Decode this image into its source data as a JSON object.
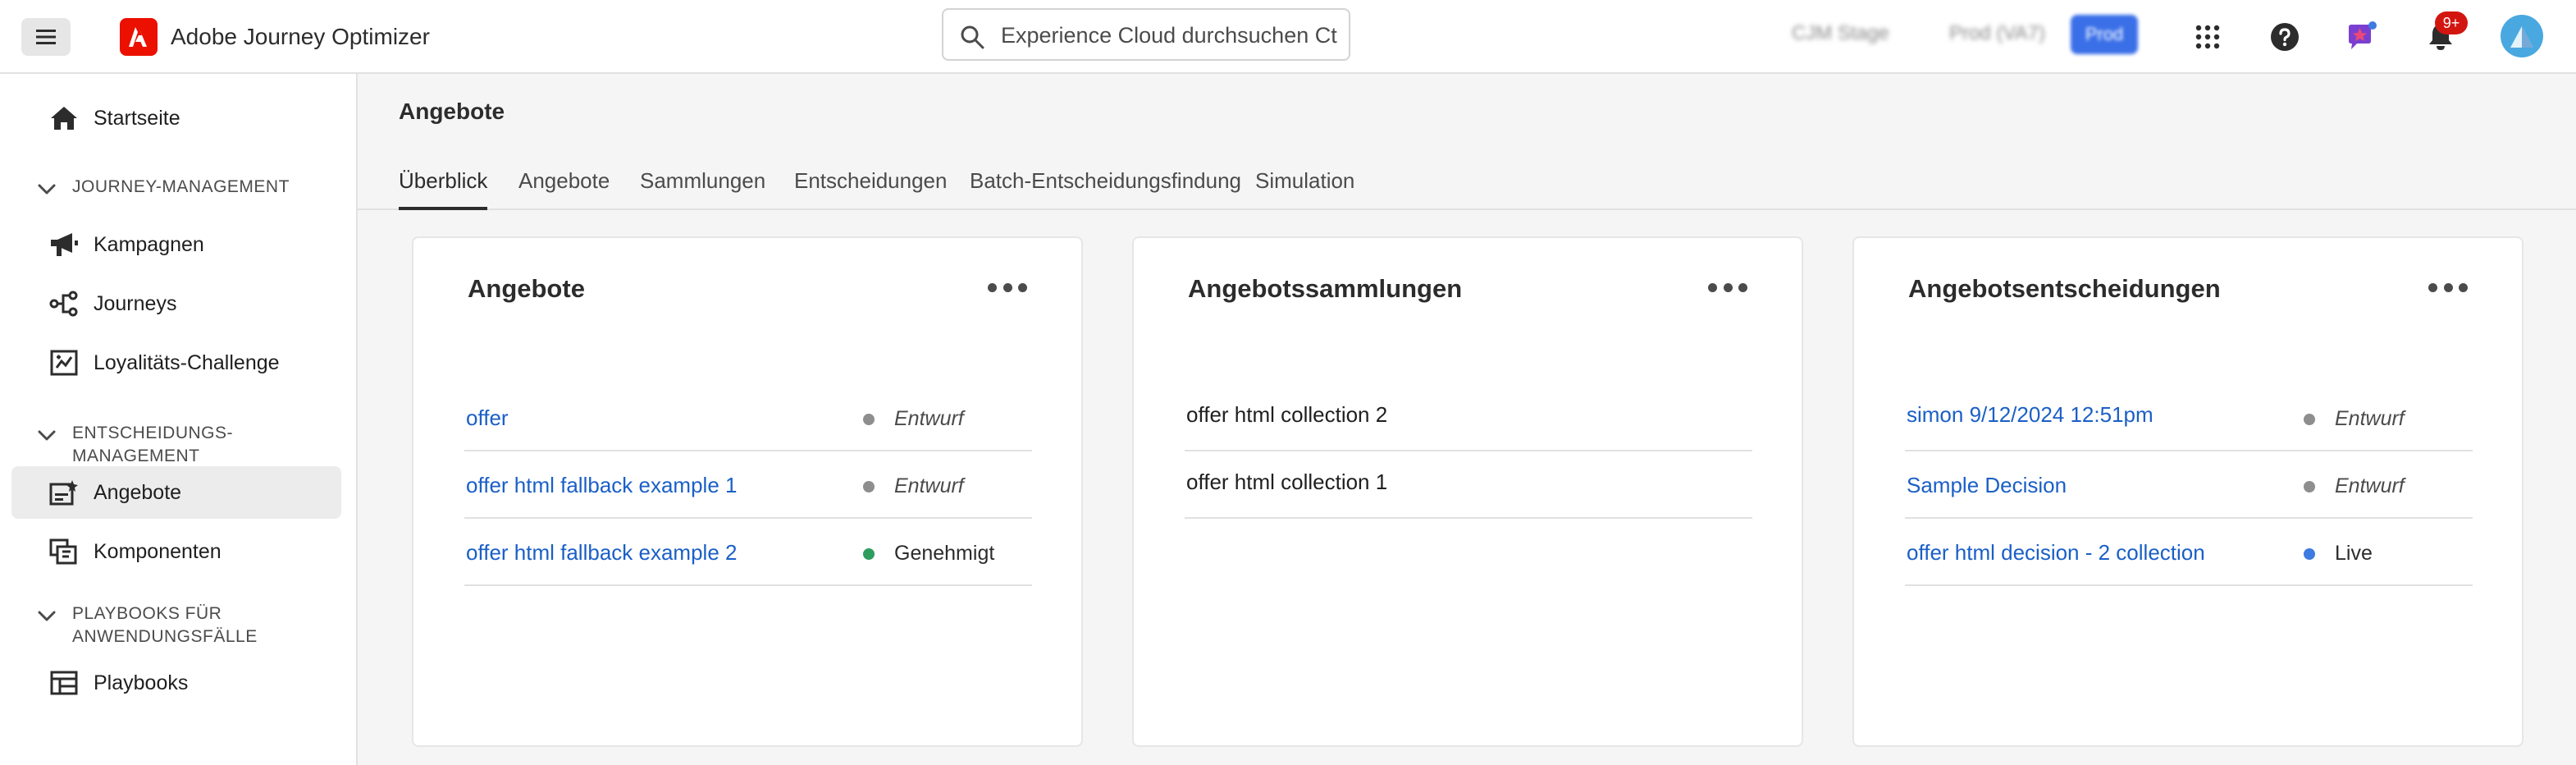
{
  "app": {
    "title": "Adobe Journey Optimizer"
  },
  "search": {
    "placeholder": "Experience Cloud durchsuchen Ctr..."
  },
  "header_blurred": {
    "org": "CJM Stage",
    "sandbox": "Prod (VA7)",
    "env_button": "Prod"
  },
  "notifications": {
    "badge": "9+"
  },
  "sidebar": {
    "home": "Startseite",
    "sections": [
      {
        "label": "JOURNEY-MANAGEMENT",
        "items": [
          "Kampagnen",
          "Journeys",
          "Loyalitäts-Challenge"
        ]
      },
      {
        "label": "ENTSCHEIDUNGS-MANAGEMENT",
        "items": [
          "Angebote",
          "Komponenten"
        ]
      },
      {
        "label": "PLAYBOOKS FÜR ANWENDUNGSFÄLLE",
        "items": [
          "Playbooks"
        ]
      }
    ],
    "active_item": "Angebote"
  },
  "page": {
    "title": "Angebote",
    "tabs": [
      "Überblick",
      "Angebote",
      "Sammlungen",
      "Entscheidungen",
      "Batch-Entscheidungsfindung",
      "Simulation"
    ],
    "active_tab": "Überblick"
  },
  "cards": [
    {
      "title": "Angebote",
      "rows": [
        {
          "name": "offer",
          "status": "Entwurf",
          "status_color": "#8e8e8e"
        },
        {
          "name": "offer html fallback example 1",
          "status": "Entwurf",
          "status_color": "#8e8e8e"
        },
        {
          "name": "offer html fallback example 2",
          "status": "Genehmigt",
          "status_color": "#2d9d5f"
        }
      ]
    },
    {
      "title": "Angebotssammlungen",
      "rows": [
        {
          "name": "offer html collection 2"
        },
        {
          "name": "offer html collection 1"
        }
      ]
    },
    {
      "title": "Angebotsentscheidungen",
      "rows": [
        {
          "name": "simon 9/12/2024 12:51pm",
          "status": "Entwurf",
          "status_color": "#8e8e8e"
        },
        {
          "name": "Sample Decision",
          "status": "Entwurf",
          "status_color": "#8e8e8e"
        },
        {
          "name": "offer html decision - 2 collection",
          "status": "Live",
          "status_color": "#3e7be0"
        }
      ]
    }
  ],
  "colors": {
    "accent": "#eb1000",
    "link": "#1a5fc7",
    "badge": "#d31510"
  }
}
